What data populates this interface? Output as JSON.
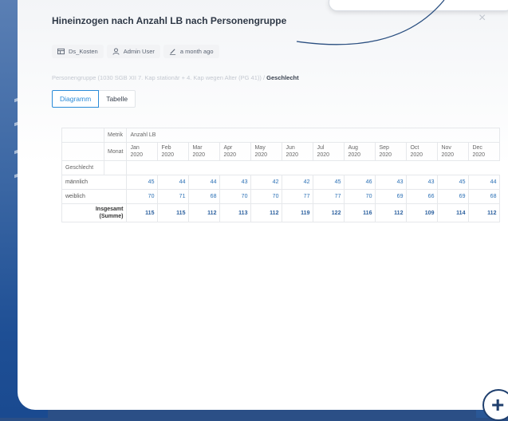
{
  "dialog": {
    "title": "Hineinzogen nach Anzahl LB nach Personengruppe",
    "close_glyph": "×"
  },
  "meta": {
    "datasource": "Ds_Kosten",
    "user": "Admin User",
    "edited": "a month ago"
  },
  "breadcrumb": {
    "parent": "Personengruppe (1030 SGB XII 7. Kap stationär + 4. Kap wegen Alter (PG 41))",
    "separator": "/",
    "current": "Geschlecht"
  },
  "tabs": {
    "diagram": "Diagramm",
    "table": "Tabelle"
  },
  "table": {
    "metric_label": "Metrik",
    "metric_value": "Anzahl LB",
    "month_label": "Monat",
    "group_label": "Geschlecht",
    "months": [
      {
        "m": "Jan",
        "y": "2020"
      },
      {
        "m": "Feb",
        "y": "2020"
      },
      {
        "m": "Mar",
        "y": "2020"
      },
      {
        "m": "Apr",
        "y": "2020"
      },
      {
        "m": "May",
        "y": "2020"
      },
      {
        "m": "Jun",
        "y": "2020"
      },
      {
        "m": "Jul",
        "y": "2020"
      },
      {
        "m": "Aug",
        "y": "2020"
      },
      {
        "m": "Sep",
        "y": "2020"
      },
      {
        "m": "Oct",
        "y": "2020"
      },
      {
        "m": "Nov",
        "y": "2020"
      },
      {
        "m": "Dec",
        "y": "2020"
      }
    ],
    "rows": [
      {
        "label": "männlich",
        "values": [
          "45",
          "44",
          "44",
          "43",
          "42",
          "42",
          "45",
          "46",
          "43",
          "43",
          "45",
          "44"
        ]
      },
      {
        "label": "weiblich",
        "values": [
          "70",
          "71",
          "68",
          "70",
          "70",
          "77",
          "77",
          "70",
          "69",
          "66",
          "69",
          "68"
        ]
      }
    ],
    "total": {
      "label_line1": "Insgesamt",
      "label_line2": "(Summe)",
      "values": [
        "115",
        "115",
        "112",
        "113",
        "112",
        "119",
        "122",
        "116",
        "112",
        "109",
        "114",
        "112"
      ]
    }
  },
  "fab": {
    "label": "+"
  }
}
